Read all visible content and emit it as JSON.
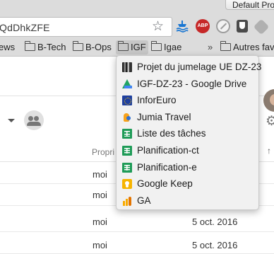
{
  "browser": {
    "profile_label": "Default Profile",
    "omnibox_text": "QdDhkZFE"
  },
  "bookmarks_bar": {
    "items": [
      {
        "label": "ews",
        "has_folder": false
      },
      {
        "label": "B-Tech",
        "has_folder": true
      },
      {
        "label": "B-Ops",
        "has_folder": true
      },
      {
        "label": "IGF",
        "has_folder": true,
        "active": true
      },
      {
        "label": "Igae",
        "has_folder": true
      }
    ],
    "overflow_label": "»",
    "other_label": "Autres favo"
  },
  "extensions": [
    "boat-icon",
    "adblock-plus-icon",
    "disabled-extension-icon",
    "shield-extension-icon",
    "tag-extension-icon"
  ],
  "bookmark_menu": {
    "items": [
      {
        "label": "Projet du jumelage UE DZ-23",
        "icon": "project-icon"
      },
      {
        "label": "IGF-DZ-23 - Google Drive",
        "icon": "google-drive-icon"
      },
      {
        "label": "InforEuro",
        "icon": "eu-flag-icon"
      },
      {
        "label": "Jumia Travel",
        "icon": "jumia-icon"
      },
      {
        "label": "Liste des tâches",
        "icon": "sheets-icon"
      },
      {
        "label": "Planification-ct",
        "icon": "sheets-icon"
      },
      {
        "label": "Planification-e",
        "icon": "sheets-icon"
      },
      {
        "label": "Google Keep",
        "icon": "keep-icon"
      },
      {
        "label": "GA",
        "icon": "analytics-icon"
      }
    ]
  },
  "content": {
    "owner_column": "Propri",
    "rows": [
      {
        "owner": "moi",
        "date": ""
      },
      {
        "owner": "moi",
        "date": ""
      },
      {
        "owner": "moi",
        "date": "5 oct. 2016"
      },
      {
        "owner": "moi",
        "date": "5 oct. 2016"
      }
    ]
  },
  "colors": {
    "chrome_gray": "#dcdcdc",
    "menu_bg": "#f1f1f1",
    "sheets_green": "#1e9b57"
  }
}
